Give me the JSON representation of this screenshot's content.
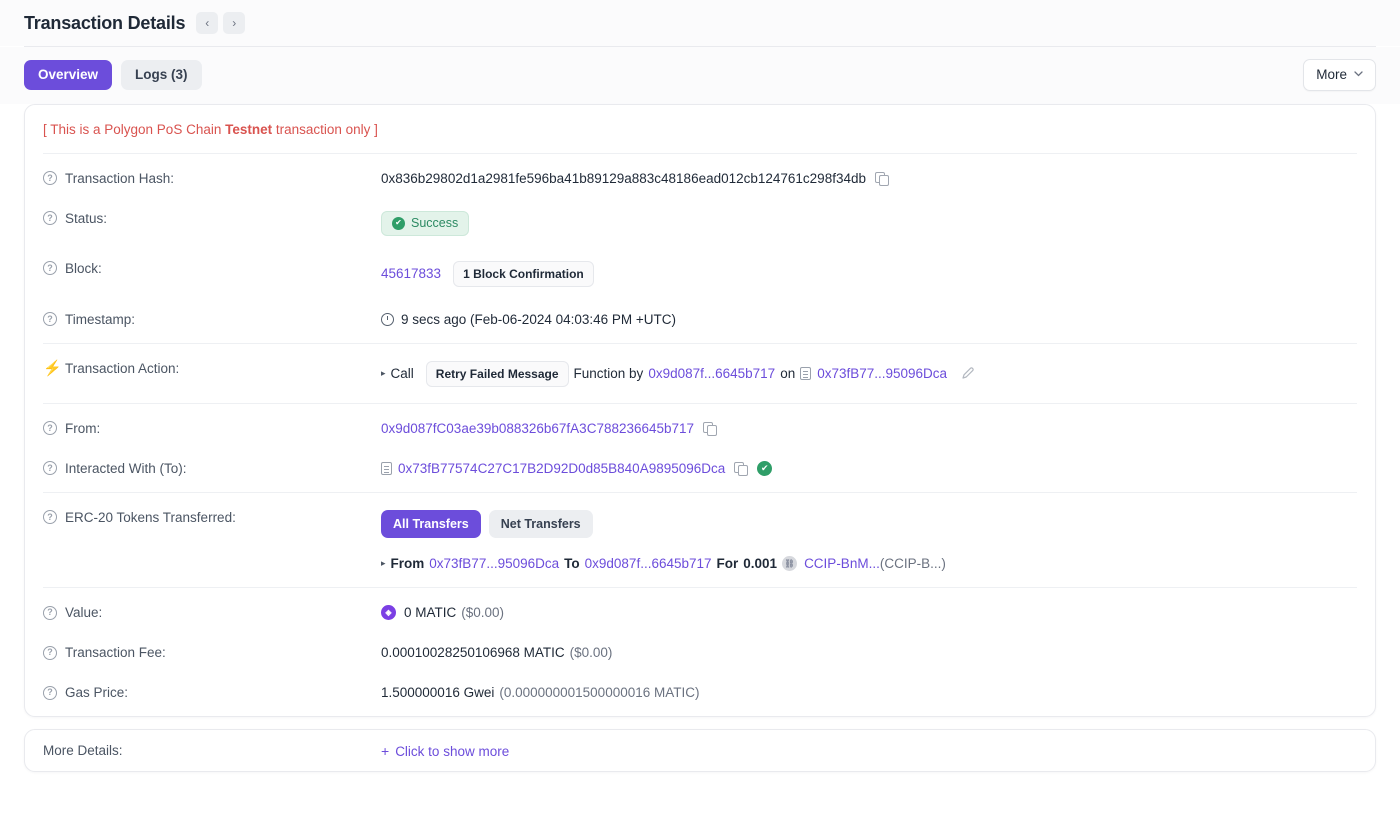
{
  "header": {
    "title": "Transaction Details",
    "prev_arrow": "‹",
    "next_arrow": "›"
  },
  "tabs": [
    {
      "label": "Overview",
      "active": true
    },
    {
      "label": "Logs (3)",
      "active": false
    }
  ],
  "more_button": {
    "label": "More",
    "chevron": "⌄"
  },
  "notice": {
    "prefix": "[ This is a Polygon PoS Chain ",
    "emphasis": "Testnet",
    "suffix": " transaction only ]"
  },
  "rows": {
    "tx_hash": {
      "label": "Transaction Hash:",
      "value": "0x836b29802d1a2981fe596ba41b89129a883c48186ead012cb124761c298f34db"
    },
    "status": {
      "label": "Status:",
      "value": "Success",
      "check": "✔"
    },
    "block": {
      "label": "Block:",
      "number": "45617833",
      "confirmation": "1 Block Confirmation"
    },
    "timestamp": {
      "label": "Timestamp:",
      "value": "9 secs ago (Feb-06-2024 04:03:46 PM +UTC)"
    },
    "action": {
      "label": "Transaction Action:",
      "caret": "▸",
      "call_word": "Call",
      "method": "Retry Failed Message",
      "function_word": "Function by",
      "by_address": "0x9d087f...6645b717",
      "on_word": "on",
      "on_address": "0x73fB77...95096Dca",
      "edit_icon": "✎"
    },
    "from": {
      "label": "From:",
      "value": "0x9d087fC03ae39b088326b67fA3C788236645b717"
    },
    "to": {
      "label": "Interacted With (To):",
      "value": "0x73fB77574C27C17B2D92D0d85B840A9895096Dca",
      "verified_check": "✔"
    },
    "erc20": {
      "label": "ERC-20 Tokens Transferred:",
      "toggle_all": "All Transfers",
      "toggle_net": "Net Transfers",
      "transfer": {
        "caret": "▸",
        "from_word": "From",
        "from_address": "0x73fB77...95096Dca",
        "to_word": "To",
        "to_address": "0x9d087f...6645b717",
        "for_word": "For",
        "amount": "0.001",
        "token_name": "CCIP-BnM...",
        "token_symbol": "(CCIP-B...)",
        "token_icon_glyph": "⛓"
      }
    },
    "value": {
      "label": "Value:",
      "amount": "0 MATIC",
      "fiat": "($0.00)",
      "token_icon_glyph": "◈"
    },
    "tx_fee": {
      "label": "Transaction Fee:",
      "amount": "0.00010028250106968 MATIC",
      "fiat": "($0.00)"
    },
    "gas_price": {
      "label": "Gas Price:",
      "amount": "1.500000016 Gwei",
      "alt": "(0.000000001500000016 MATIC)"
    },
    "more_details": {
      "label": "More Details:",
      "link": "Click to show more",
      "plus": "+"
    }
  }
}
